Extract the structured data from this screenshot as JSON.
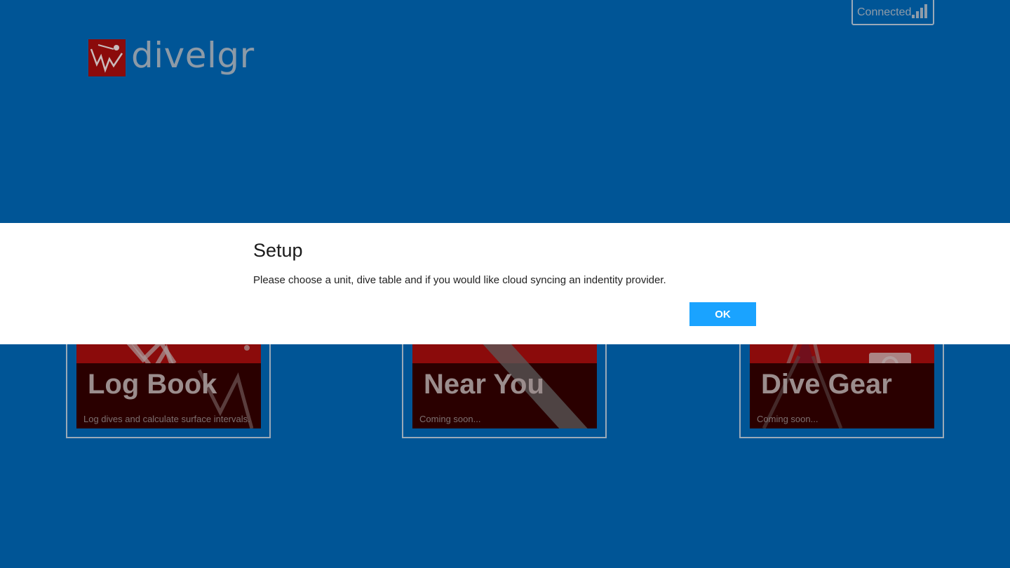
{
  "header": {
    "app_name": "divelgr",
    "status_text": "Connected",
    "status_icon": "signal-bars-icon"
  },
  "tiles": [
    {
      "title": "Log Book",
      "subtitle": "Log dives and calculate surface intervals.",
      "icon": "dive-profile-icon"
    },
    {
      "title": "Near You",
      "subtitle": "Coming soon...",
      "icon": "dive-flag-icon"
    },
    {
      "title": "Dive Gear",
      "subtitle": "Coming soon...",
      "icon": "gear-fin-icon"
    }
  ],
  "dialog": {
    "title": "Setup",
    "message": "Please choose a unit, dive table and if you would like cloud syncing an indentity provider.",
    "ok_label": "OK"
  },
  "colors": {
    "background": "#005596",
    "tile_red": "#8b0b0b",
    "button_accent": "#1aa3ff"
  }
}
